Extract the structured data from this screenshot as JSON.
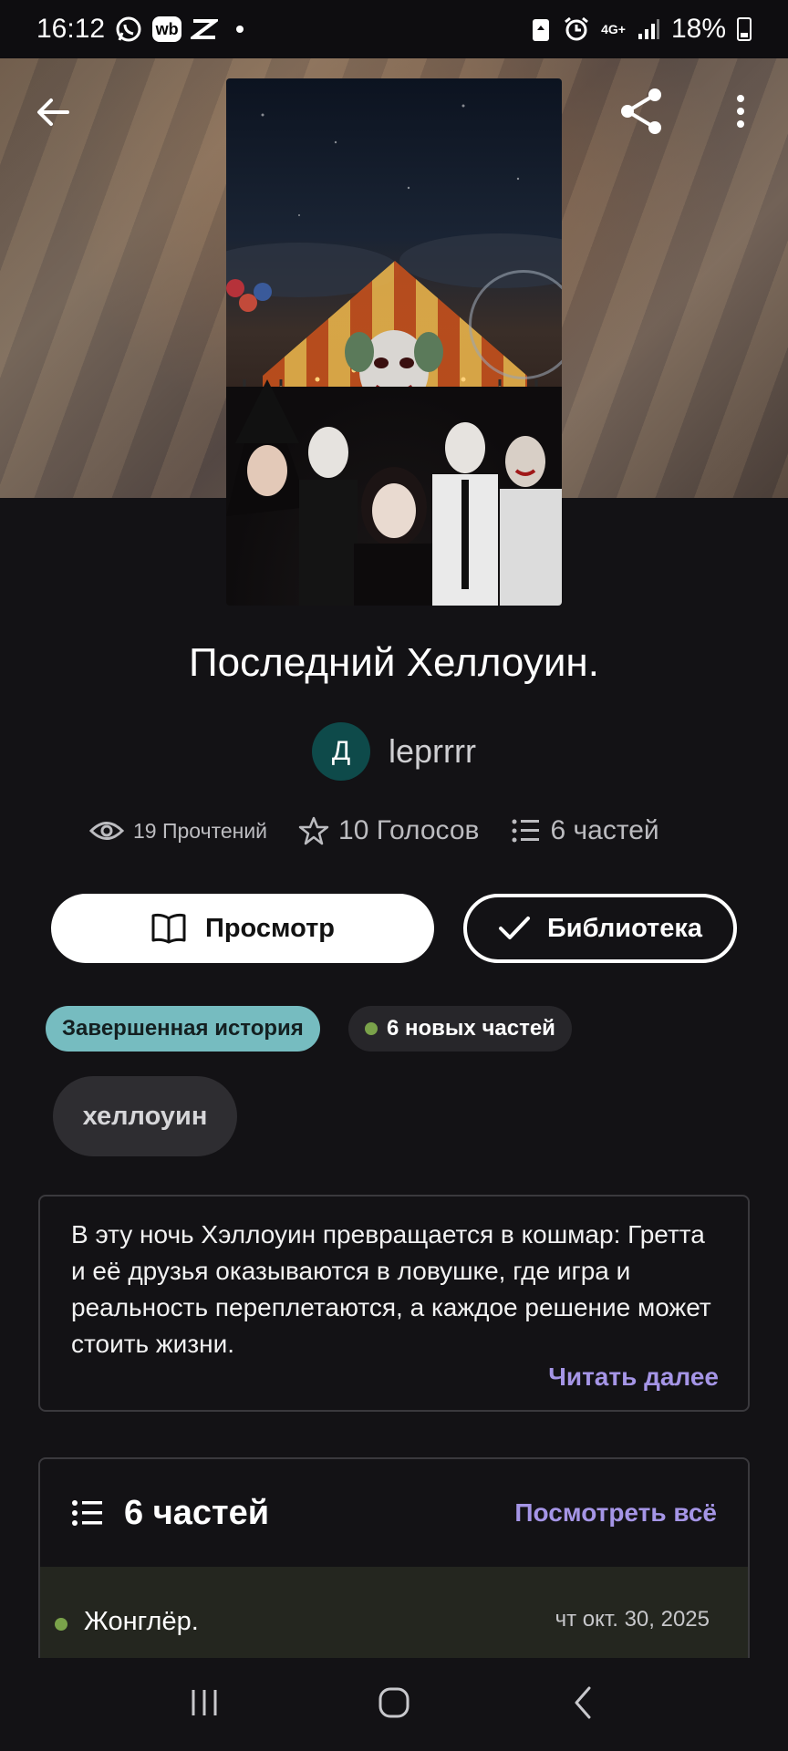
{
  "status_bar": {
    "time": "16:12",
    "wb_label": "wb",
    "network": "4G+",
    "battery": "18%",
    "icons": [
      "whatsapp-icon",
      "wb-icon",
      "capcut-icon",
      "dot-icon",
      "battery-saver-icon",
      "alarm-icon",
      "signal-icon",
      "battery-icon"
    ]
  },
  "story": {
    "title": "Последний Хеллоуин.",
    "author_initial": "Д",
    "author": "leprrrr",
    "reads": "19 Прочтений",
    "votes": "10 Голосов",
    "parts": "6 частей"
  },
  "actions": {
    "view_label": "Просмотр",
    "library_label": "Библиотека"
  },
  "badges": {
    "complete": "Завершенная история",
    "new_parts": "6 новых частей"
  },
  "tags": [
    "хеллоуин"
  ],
  "description": {
    "text": "В эту ночь Хэллоуин превращается в кошмар: Гретта и её друзья оказываются в ловушке, где игра и реальность переплетаются, а каждое решение может стоить жизни.",
    "read_more": "Читать далее"
  },
  "parts_section": {
    "header": "6 частей",
    "see_all": "Посмотреть всё",
    "items": [
      {
        "name": "Жонглёр.",
        "date": "чт окт. 30, 2025"
      }
    ]
  },
  "colors": {
    "accent": "#a595e6",
    "complete_badge": "#76bcc0",
    "new_dot": "#7aa24a",
    "background": "#131215"
  }
}
